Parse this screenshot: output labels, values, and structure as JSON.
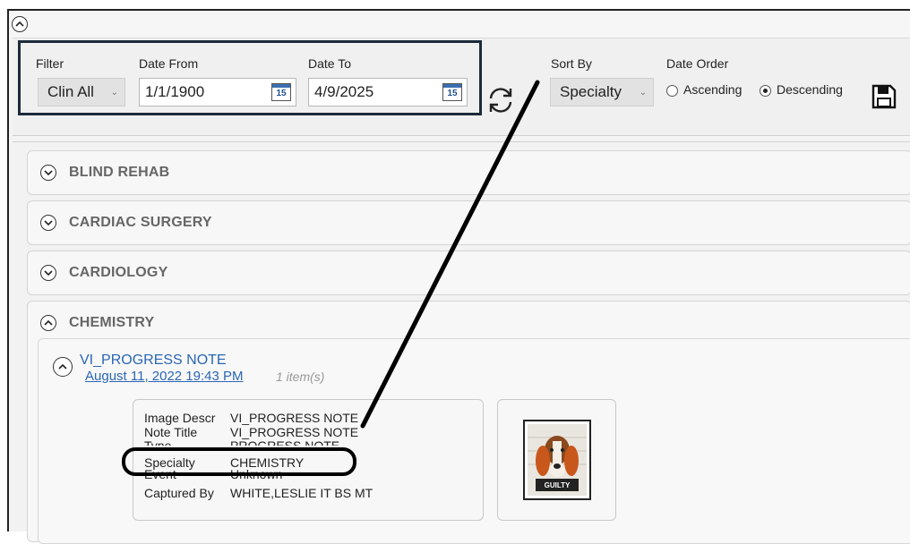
{
  "toolbar": {
    "filter_label": "Filter",
    "filter_value": "Clin All",
    "date_from_label": "Date From",
    "date_from_value": "1/1/1900",
    "date_to_label": "Date To",
    "date_to_value": "4/9/2025",
    "calendar_day": "15",
    "sort_by_label": "Sort By",
    "sort_by_value": "Specialty",
    "date_order_label": "Date Order",
    "ascending_label": "Ascending",
    "descending_label": "Descending",
    "date_order_selected": "Descending"
  },
  "groups": [
    {
      "label": "BLIND REHAB",
      "expanded": false
    },
    {
      "label": "CARDIAC SURGERY",
      "expanded": false
    },
    {
      "label": "CARDIOLOGY",
      "expanded": false
    },
    {
      "label": "CHEMISTRY",
      "expanded": true
    }
  ],
  "note": {
    "title": "VI_PROGRESS NOTE",
    "date": "August 11, 2022 19:43 PM",
    "count": "1 item(s)"
  },
  "details": {
    "image_descr_label": "Image Descr",
    "image_descr_value": "VI_PROGRESS NOTE",
    "note_title_label": "Note Title",
    "note_title_value": "VI_PROGRESS NOTE",
    "type_label": "Type",
    "type_value": "PROGRESS NOTE",
    "specialty_label": "Specialty",
    "specialty_value": "CHEMISTRY",
    "event_label": "Event",
    "event_value": "Unknown",
    "captured_by_label": "Captured By",
    "captured_by_value": "WHITE,LESLIE IT BS MT"
  },
  "thumbnail": {
    "caption": "GUILTY",
    "icon": "dog-mugshot-image"
  },
  "colors": {
    "highlight_box": "#1c2b3a",
    "link": "#2a66b4",
    "annotation": "#000000"
  }
}
